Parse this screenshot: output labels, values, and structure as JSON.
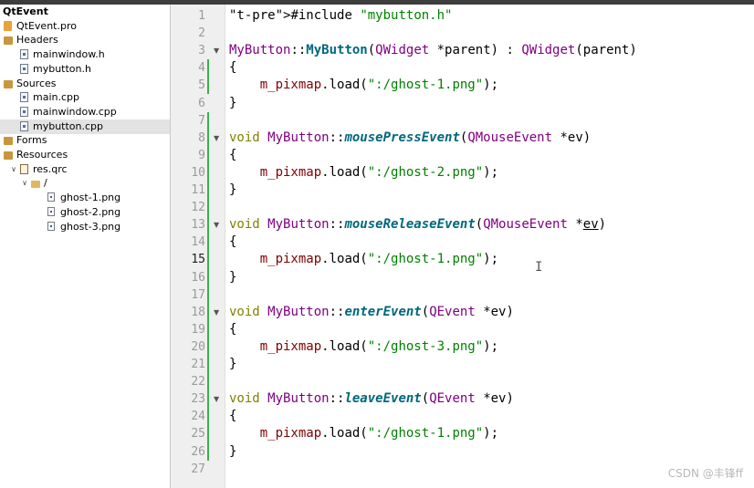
{
  "project_tree": {
    "items": [
      {
        "label": "QtEvent",
        "depth": 0,
        "kind": "root"
      },
      {
        "label": "QtEvent.pro",
        "depth": 0,
        "kind": "pro-file"
      },
      {
        "label": "Headers",
        "depth": 0,
        "kind": "folder"
      },
      {
        "label": "mainwindow.h",
        "depth": 1,
        "kind": "file"
      },
      {
        "label": "mybutton.h",
        "depth": 1,
        "kind": "file"
      },
      {
        "label": "Sources",
        "depth": 0,
        "kind": "folder"
      },
      {
        "label": "main.cpp",
        "depth": 1,
        "kind": "file"
      },
      {
        "label": "mainwindow.cpp",
        "depth": 1,
        "kind": "file"
      },
      {
        "label": "mybutton.cpp",
        "depth": 1,
        "kind": "file",
        "selected": true
      },
      {
        "label": "Forms",
        "depth": 0,
        "kind": "folder"
      },
      {
        "label": "Resources",
        "depth": 0,
        "kind": "folder"
      },
      {
        "label": "res.qrc",
        "depth": 1,
        "kind": "qrc",
        "expanded": true
      },
      {
        "label": "/",
        "depth": 2,
        "kind": "folder-open",
        "expanded": true
      },
      {
        "label": "ghost-1.png",
        "depth": 3,
        "kind": "png"
      },
      {
        "label": "ghost-2.png",
        "depth": 3,
        "kind": "png"
      },
      {
        "label": "ghost-3.png",
        "depth": 3,
        "kind": "png"
      }
    ]
  },
  "editor": {
    "current_line": 15,
    "lines": [
      {
        "n": "1",
        "code": "#include \"mybutton.h\""
      },
      {
        "n": "2",
        "code": ""
      },
      {
        "n": "3",
        "code": "MyButton::MyButton(QWidget *parent) : QWidget(parent)",
        "fold": true
      },
      {
        "n": "4",
        "code": "{"
      },
      {
        "n": "5",
        "code": "    m_pixmap.load(\":/ghost-1.png\");"
      },
      {
        "n": "6",
        "code": "}"
      },
      {
        "n": "7",
        "code": ""
      },
      {
        "n": "8",
        "code": "void MyButton::mousePressEvent(QMouseEvent *ev)",
        "fold": true
      },
      {
        "n": "9",
        "code": "{"
      },
      {
        "n": "10",
        "code": "    m_pixmap.load(\":/ghost-2.png\");"
      },
      {
        "n": "11",
        "code": "}"
      },
      {
        "n": "12",
        "code": ""
      },
      {
        "n": "13",
        "code": "void MyButton::mouseReleaseEvent(QMouseEvent *ev)",
        "fold": true
      },
      {
        "n": "14",
        "code": "{"
      },
      {
        "n": "15",
        "code": "    m_pixmap.load(\":/ghost-1.png\");"
      },
      {
        "n": "16",
        "code": "}"
      },
      {
        "n": "17",
        "code": ""
      },
      {
        "n": "18",
        "code": "void MyButton::enterEvent(QEvent *ev)",
        "fold": true
      },
      {
        "n": "19",
        "code": "{"
      },
      {
        "n": "20",
        "code": "    m_pixmap.load(\":/ghost-3.png\");"
      },
      {
        "n": "21",
        "code": "}"
      },
      {
        "n": "22",
        "code": ""
      },
      {
        "n": "23",
        "code": "void MyButton::leaveEvent(QEvent *ev)",
        "fold": true
      },
      {
        "n": "24",
        "code": "{"
      },
      {
        "n": "25",
        "code": "    m_pixmap.load(\":/ghost-1.png\");"
      },
      {
        "n": "26",
        "code": "}"
      },
      {
        "n": "27",
        "code": ""
      }
    ]
  },
  "watermark": "CSDN @丰锋ff",
  "colors": {
    "preprocessor": "#000080",
    "string": "#008000",
    "keyword": "#808000",
    "class": "#800080",
    "function": "#00677c",
    "member": "#800000",
    "change_marker": "#38b24a",
    "selection": "#e3e3e3"
  }
}
